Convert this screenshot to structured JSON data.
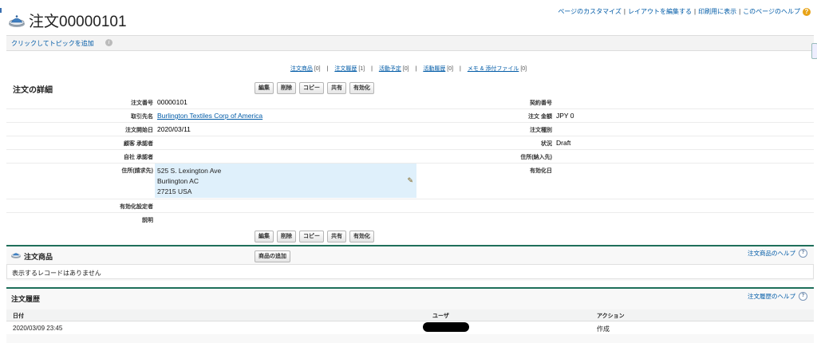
{
  "header": {
    "title": "注文00000101",
    "links": [
      "ページのカスタマイズ",
      "レイアウトを編集する",
      "印刷用に表示",
      "このページのヘルプ"
    ]
  },
  "topic_bar": {
    "link": "クリックしてトピックを追加"
  },
  "related_links": [
    {
      "label": "注文商品",
      "count": "[0]"
    },
    {
      "label": "注文履歴",
      "count": "[1]"
    },
    {
      "label": "活動予定",
      "count": "[0]"
    },
    {
      "label": "活動履歴",
      "count": "[0]"
    },
    {
      "label": "メモ & 添付ファイル",
      "count": "[0]"
    }
  ],
  "detail": {
    "heading": "注文の詳細",
    "buttons": [
      "編集",
      "削除",
      "コピー",
      "共有",
      "有効化"
    ],
    "fields": {
      "order_number_label": "注文番号",
      "order_number": "00000101",
      "contract_label": "契約番号",
      "contract": "",
      "account_label": "取引先名",
      "account": "Burlington Textiles Corp of America",
      "amount_label": "注文 金額",
      "amount": "JPY 0",
      "start_label": "注文開始日",
      "start": "2020/03/11",
      "type_label": "注文種別",
      "type": "",
      "customer_approver_label": "顧客 承認者",
      "customer_approver": "",
      "status_label": "状況",
      "status": "Draft",
      "company_approver_label": "自社 承認者",
      "company_approver": "",
      "shipping_label": "住所(納入先)",
      "shipping": "",
      "billing_label": "住所(請求先)",
      "billing_lines": [
        "525 S. Lexington Ave",
        "Burlington AC",
        "27215 USA"
      ],
      "activated_date_label": "有効化日",
      "activated_date": "",
      "activated_by_label": "有効化設定者",
      "activated_by": "",
      "description_label": "説明",
      "description": ""
    }
  },
  "products": {
    "title": "注文商品",
    "add_button": "商品の追加",
    "help": "注文商品のヘルプ",
    "empty": "表示するレコードはありません"
  },
  "history": {
    "title": "注文履歴",
    "help": "注文履歴のヘルプ",
    "columns": [
      "日付",
      "ユーザ",
      "アクション"
    ],
    "rows": [
      {
        "date": "2020/03/09 23:45",
        "user": "",
        "action": "作成"
      }
    ]
  }
}
